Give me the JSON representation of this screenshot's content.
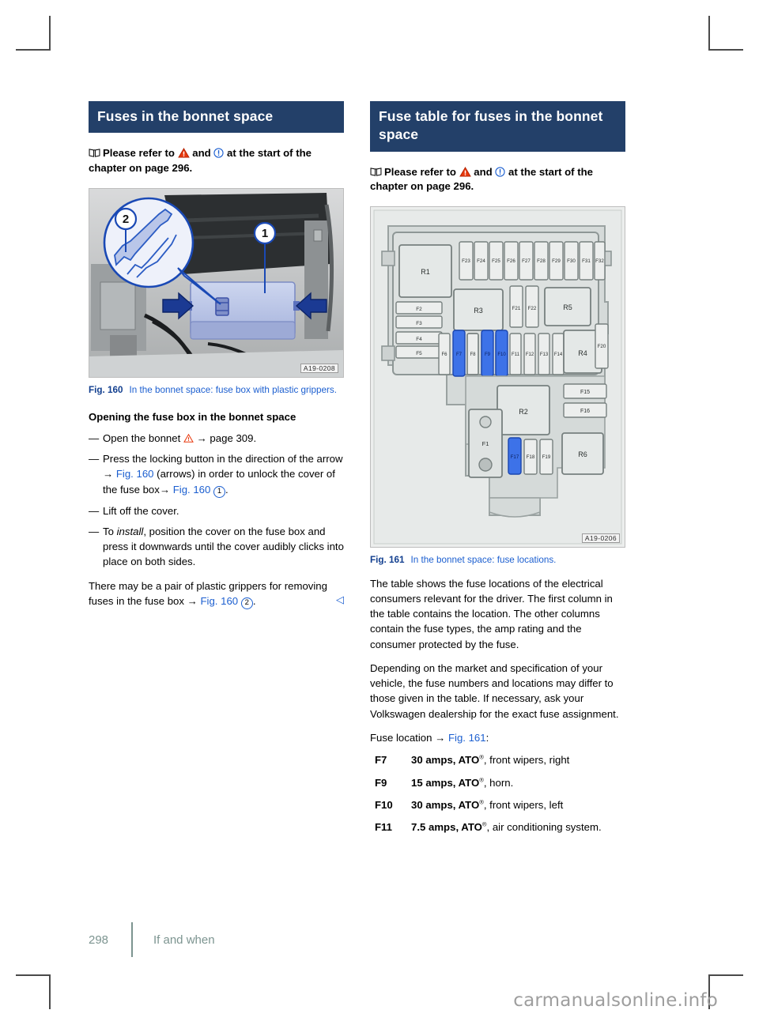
{
  "left": {
    "heading": "Fuses in the bonnet space",
    "refer": {
      "prefix": "Please refer to",
      "middle": "and",
      "suffix": "at the start of the chapter on page 296."
    },
    "figure": {
      "label": "Fig. 160",
      "caption": "In the bonnet space: fuse box with plastic grippers.",
      "code": "A19-0208",
      "callouts": [
        "1",
        "2"
      ]
    },
    "subhead": "Opening the fuse box in the bonnet space",
    "bullets": [
      {
        "parts": [
          "Open the bonnet ",
          " → page 309."
        ]
      },
      {
        "parts": [
          "Press the locking button in the direction of the arrow → ",
          "Fig. 160",
          " (arrows) in order to unlock the cover of the fuse box→ ",
          "Fig. 160",
          " ",
          "1",
          "."
        ]
      },
      {
        "parts": [
          "Lift off the cover."
        ]
      },
      {
        "parts": [
          "To ",
          "install",
          ", position the cover on the fuse box and press it downwards until the cover audibly clicks into place on both sides."
        ]
      }
    ],
    "closing": {
      "pre": "There may be a pair of plastic grippers for removing fuses in the fuse box → ",
      "xref": "Fig. 160",
      "circle": "2",
      "post": ".",
      "endmark": "◁"
    }
  },
  "right": {
    "heading": "Fuse table for fuses in the bonnet space",
    "refer": {
      "prefix": "Please refer to",
      "middle": "and",
      "suffix": "at the start of the chapter on page 296."
    },
    "figure": {
      "label": "Fig. 161",
      "caption": "In the bonnet space: fuse locations.",
      "code": "A19-0206"
    },
    "paragraphs": [
      "The table shows the fuse locations of the electrical consumers relevant for the driver. The first column in the table contains the location. The other columns contain the fuse types, the amp rating and the consumer protected by the fuse.",
      "Depending on the market and specification of your vehicle, the fuse numbers and locations may differ to those given in the table. If necessary, ask your Volkswagen dealership for the exact fuse assignment."
    ],
    "location_line": {
      "pre": "Fuse location → ",
      "xref": "Fig. 161",
      "post": ":"
    },
    "fuses": [
      {
        "id": "F7",
        "rating": "30 amps, ATO",
        "desc": ", front wipers, right"
      },
      {
        "id": "F9",
        "rating": "15 amps, ATO",
        "desc": ", horn."
      },
      {
        "id": "F10",
        "rating": "30 amps, ATO",
        "desc": ", front wipers, left"
      },
      {
        "id": "F11",
        "rating": "7.5 amps, ATO",
        "desc": ", air conditioning system."
      }
    ]
  },
  "diagram": {
    "relays": [
      "R1",
      "R2",
      "R3",
      "R4",
      "R5",
      "R6"
    ],
    "top_row": [
      "F23",
      "F24",
      "F25",
      "F26",
      "F27",
      "F28",
      "F29",
      "F30",
      "F31",
      "F32"
    ],
    "mid_pair": [
      "F21",
      "F22"
    ],
    "left_col": [
      "F2",
      "F3",
      "F4",
      "F5"
    ],
    "main_row": [
      "F6",
      "F7",
      "F8",
      "F9",
      "F10",
      "F11",
      "F12",
      "F13",
      "F14"
    ],
    "right_col": [
      "F15",
      "F16"
    ],
    "bottom_row": [
      "F17",
      "F18",
      "F19"
    ],
    "big_fuse": "F1",
    "side_fuse": "F20",
    "highlighted": [
      "F7",
      "F9",
      "F10",
      "F17"
    ],
    "highlight_color": "#3d72e8"
  },
  "footer": {
    "page": "298",
    "section": "If and when"
  },
  "watermark": "carmanualsonline.info"
}
